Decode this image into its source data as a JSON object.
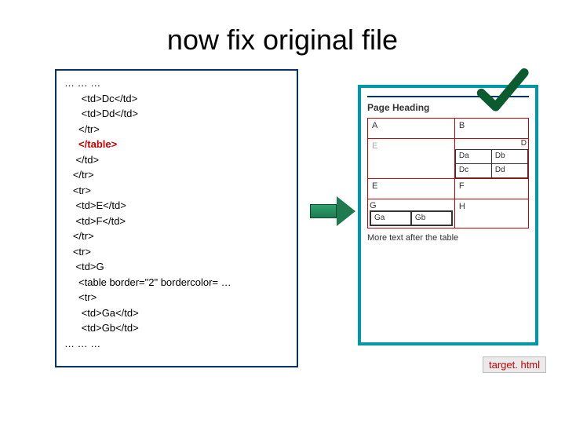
{
  "title": "now fix original file",
  "code": {
    "ellipsis_top": "… … …",
    "l1": "      <td>Dc</td>",
    "l2": "      <td>Dd</td>",
    "l3": "     </tr>",
    "l4": "     </table>",
    "l5": "    </td>",
    "l6": "   </tr>",
    "l7": "   <tr>",
    "l8": "    <td>E</td>",
    "l9": "    <td>F</td>",
    "l10": "   </tr>",
    "l11": "   <tr>",
    "l12": "    <td>G",
    "l13": "     <table border=\"2\" bordercolor= …",
    "l14": "     <tr>",
    "l15": "      <td>Ga</td>",
    "l16": "      <td>Gb</td>",
    "ellipsis_bot": "… … …"
  },
  "preview": {
    "heading": "Page Heading",
    "outer": {
      "r1c1": "A",
      "r1c2": "B",
      "r2c2_label": "D",
      "r2_inner": {
        "a": "Da",
        "b": "Db",
        "c": "Dc",
        "d": "Dd"
      },
      "r3c1": "E",
      "r3c2": "F",
      "r4c1_label": "G",
      "r4_inner": {
        "a": "Ga",
        "b": "Gb"
      },
      "r4c2": "H"
    },
    "more": "More text after the table"
  },
  "filename": "target. html"
}
